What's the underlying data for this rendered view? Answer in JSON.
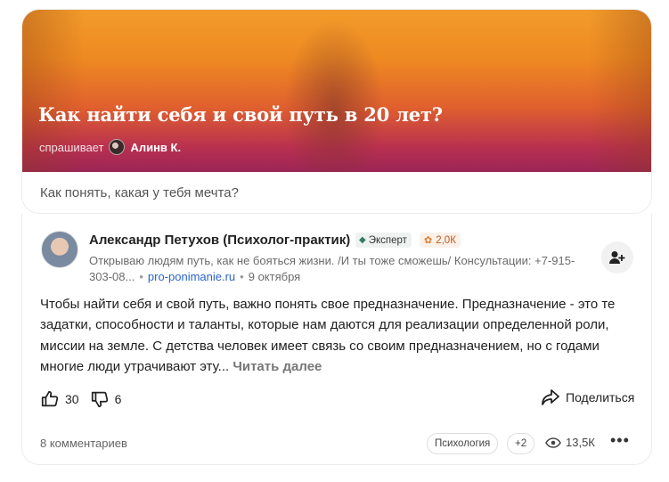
{
  "question": {
    "title": "Как найти себя и свой путь в 20 лет?",
    "asker_label": "спрашивает",
    "asker_name": "Алинв К.",
    "text": "Как понять, какая у тебя мечта?"
  },
  "answer": {
    "author_name": "Александр Петухов (Психолог-практик)",
    "expert_label": "Эксперт",
    "rating": "2,0К",
    "bio": "Открываю людям путь, как не бояться жизни. /И ты тоже сможешь/ Консультации: +7-915-303-08...",
    "bio_link": "pro-ponimanie.ru",
    "date": "9 октября",
    "text": "Чтобы найти себя и свой путь, важно понять свое предназначение. Предназначение - это те задатки, способности и таланты, которые нам даются для реализации определенной роли, миссии на земле. С детства человек имеет связь со своим предназначением, но с годами многие люди утрачивают эту...",
    "read_more": "Читать далее",
    "likes": "30",
    "dislikes": "6",
    "share_label": "Поделиться",
    "comments": "8 комментариев",
    "tags": [
      "Психология",
      "+2"
    ],
    "views": "13,5К"
  },
  "icons": {
    "follow": "add-user-icon",
    "like": "thumb-up-icon",
    "dislike": "thumb-down-icon",
    "share": "share-icon",
    "views": "eye-icon",
    "more": "more-dots-icon",
    "expert": "gem-icon",
    "rating": "flower-icon"
  },
  "colors": {
    "link": "#2a64c7",
    "rating": "#c05a1a",
    "expert_bg": "#eef3f1",
    "hero_top": "#f29b2a",
    "hero_bottom": "#9c2556"
  }
}
